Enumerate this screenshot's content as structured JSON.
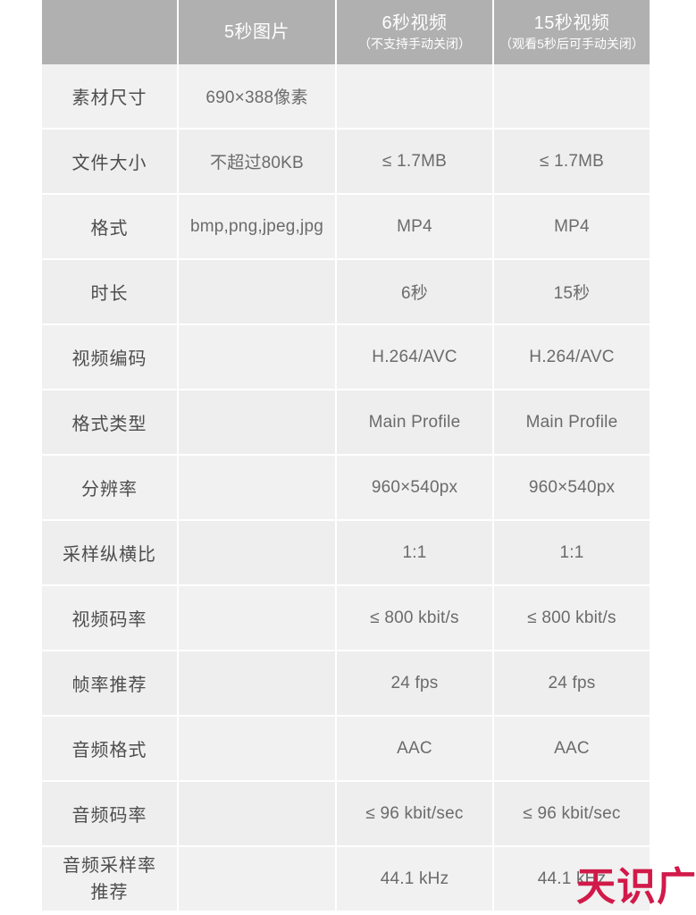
{
  "table": {
    "columns": [
      {
        "id": "spec",
        "title": "",
        "subtitle": ""
      },
      {
        "id": "image5s",
        "title": "5秒图片",
        "subtitle": ""
      },
      {
        "id": "video6s",
        "title": "6秒视频",
        "subtitle": "（不支持手动关闭）"
      },
      {
        "id": "video15s",
        "title": "15秒视频",
        "subtitle": "（观看5秒后可手动关闭）"
      }
    ],
    "rows": [
      {
        "label": "素材尺寸",
        "label2": "",
        "image5s": "690×388像素",
        "video6s": "",
        "video15s": ""
      },
      {
        "label": "文件大小",
        "label2": "",
        "image5s": "不超过80KB",
        "video6s": "≤ 1.7MB",
        "video15s": "≤ 1.7MB"
      },
      {
        "label": "格式",
        "label2": "",
        "image5s": "bmp,png,jpeg,jpg",
        "video6s": "MP4",
        "video15s": "MP4"
      },
      {
        "label": "时长",
        "label2": "",
        "image5s": "",
        "video6s": "6秒",
        "video15s": "15秒"
      },
      {
        "label": "视频编码",
        "label2": "",
        "image5s": "",
        "video6s": "H.264/AVC",
        "video15s": "H.264/AVC"
      },
      {
        "label": "格式类型",
        "label2": "",
        "image5s": "",
        "video6s": "Main Profile",
        "video15s": "Main Profile"
      },
      {
        "label": "分辨率",
        "label2": "",
        "image5s": "",
        "video6s": "960×540px",
        "video15s": "960×540px"
      },
      {
        "label": "采样纵横比",
        "label2": "",
        "image5s": "",
        "video6s": "1:1",
        "video15s": "1:1"
      },
      {
        "label": "视频码率",
        "label2": "",
        "image5s": "",
        "video6s": "≤ 800 kbit/s",
        "video15s": "≤ 800 kbit/s"
      },
      {
        "label": "帧率推荐",
        "label2": "",
        "image5s": "",
        "video6s": "24 fps",
        "video15s": "24 fps"
      },
      {
        "label": "音频格式",
        "label2": "",
        "image5s": "",
        "video6s": "AAC",
        "video15s": "AAC"
      },
      {
        "label": "音频码率",
        "label2": "",
        "image5s": "",
        "video6s": "≤ 96 kbit/sec",
        "video15s": "≤ 96 kbit/sec"
      },
      {
        "label": "音频采样率",
        "label2": "推荐",
        "image5s": "",
        "video6s": "44.1 kHz",
        "video15s": "44.1 kHz"
      }
    ]
  },
  "watermark": {
    "text": "天识广告",
    "color": "#d11a4a"
  },
  "colors": {
    "header_background": "#b0b0b0",
    "header_text": "#ffffff",
    "cell_background": "#f1f1f1",
    "cell_background_alt": "#eeeeee",
    "label_text": "#4d4d4d",
    "value_text": "#6b6b6b",
    "grid_line": "#ffffff",
    "page_background": "#ffffff"
  }
}
